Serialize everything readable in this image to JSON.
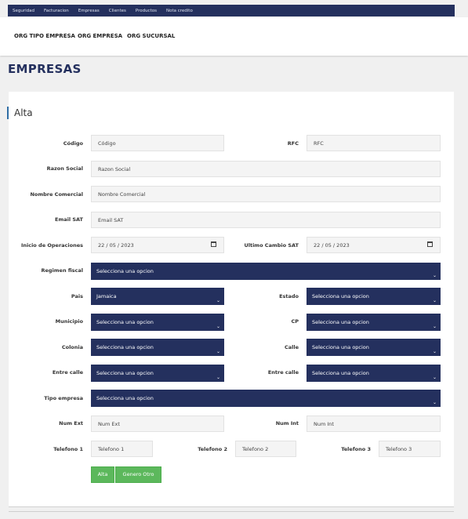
{
  "topnav": [
    "Seguridad",
    "Facturacion",
    "Empresas",
    "Clientes",
    "Productos",
    "Nota credito"
  ],
  "subnav": [
    "ORG TIPO EMPRESA",
    "ORG EMPRESA",
    "ORG SUCURSAL"
  ],
  "page_title": "EMPRESAS",
  "section_title": "Alta",
  "labels": {
    "codigo": "Código",
    "rfc": "RFC",
    "razon_social": "Razon Social",
    "nombre_comercial": "Nombre Comercial",
    "email_sat": "Email SAT",
    "inicio_operaciones": "Inicio de Operaciones",
    "ultimo_cambio_sat": "Ultimo Cambio SAT",
    "regimen_fiscal": "Regimen fiscal",
    "pais": "Pais",
    "estado": "Estado",
    "municipio": "Municipio",
    "cp": "CP",
    "colonia": "Colonia",
    "calle": "Calle",
    "entre_calle_1": "Entre calle",
    "entre_calle_2": "Entre calle",
    "tipo_empresa": "Tipo empresa",
    "num_ext": "Num Ext",
    "num_int": "Num Int",
    "telefono1": "Telefono 1",
    "telefono2": "Telefono 2",
    "telefono3": "Telefono 3"
  },
  "placeholders": {
    "codigo": "Código",
    "rfc": "RFC",
    "razon_social": "Razon Social",
    "nombre_comercial": "Nombre Comercial",
    "email_sat": "Email SAT",
    "num_ext": "Num Ext",
    "num_int": "Num Int",
    "telefono1": "Telefono 1",
    "telefono2": "Telefono 2",
    "telefono3": "Telefono 3"
  },
  "dates": {
    "inicio_operaciones": "22 / 05 / 2023",
    "ultimo_cambio_sat": "22 / 05 / 2023"
  },
  "selects": {
    "regimen_fiscal": "Selecciona una opcion",
    "pais": "Jamaica",
    "estado": "Selecciona una opcion",
    "municipio": "Selecciona una opcion",
    "cp": "Selecciona una opcion",
    "colonia": "Selecciona una opcion",
    "calle": "Selecciona una opcion",
    "entre_calle_1": "Selecciona una opcion",
    "entre_calle_2": "Selecciona una opcion",
    "tipo_empresa": "Selecciona una opcion"
  },
  "buttons": {
    "alta": "Alta",
    "genero_otro": "Genero Otro"
  },
  "icons": {
    "select_arrow": "chevron-down-icon",
    "date_picker": "calendar-icon"
  },
  "colors": {
    "navy": "#24305e",
    "green": "#5cb85c",
    "accent": "#2e6da4"
  }
}
